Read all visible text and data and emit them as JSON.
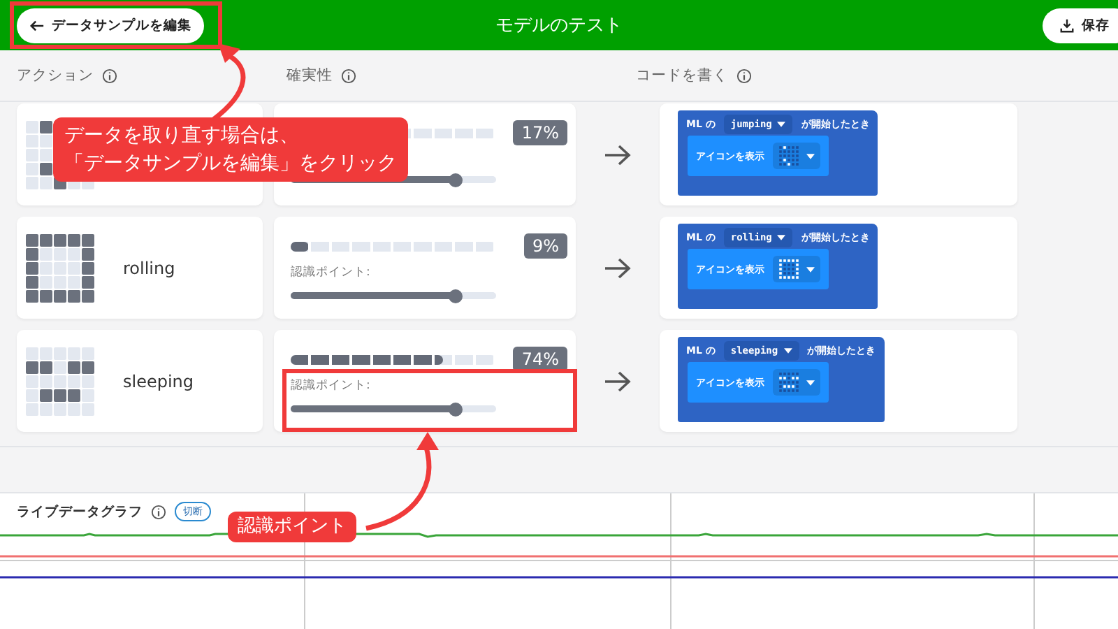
{
  "header": {
    "back_button": "データサンプルを編集",
    "title": "モデルのテスト",
    "save_button": "保存"
  },
  "column_headers": [
    "アクション",
    "確実性",
    "コードを書く"
  ],
  "rows": [
    {
      "name": null,
      "confidence": {
        "level": 0.17
      },
      "percent": "17%",
      "threshold_label": null,
      "threshold": {
        "level": 0.8
      },
      "code": {
        "prefix": "ML の",
        "event": "jumping",
        "suffix": "が開始したとき",
        "action": "アイコンを表示"
      }
    },
    {
      "name": "rolling",
      "confidence": {
        "level": 0.09
      },
      "percent": "9%",
      "threshold_label": "認識ポイント:",
      "threshold": {
        "level": 0.8
      },
      "code": {
        "prefix": "ML の",
        "event": "rolling",
        "suffix": "が開始したとき",
        "action": "アイコンを表示"
      }
    },
    {
      "name": "sleeping",
      "confidence": {
        "level": 0.74
      },
      "percent": "74%",
      "threshold_label": "認識ポイント:",
      "threshold": {
        "level": 0.8
      },
      "code": {
        "prefix": "ML の",
        "event": "sleeping",
        "suffix": "が開始したとき",
        "action": "アイコンを表示"
      }
    }
  ],
  "graph": {
    "title": "ライブデータグラフ",
    "status": "切断"
  },
  "annotations": [
    {
      "kind": "callout-top",
      "lines": [
        "データを取り直す場合は、",
        "「データサンプルを編集」をクリック"
      ]
    },
    {
      "kind": "callout-bottom",
      "lines": [
        "認識ポイント"
      ]
    }
  ]
}
